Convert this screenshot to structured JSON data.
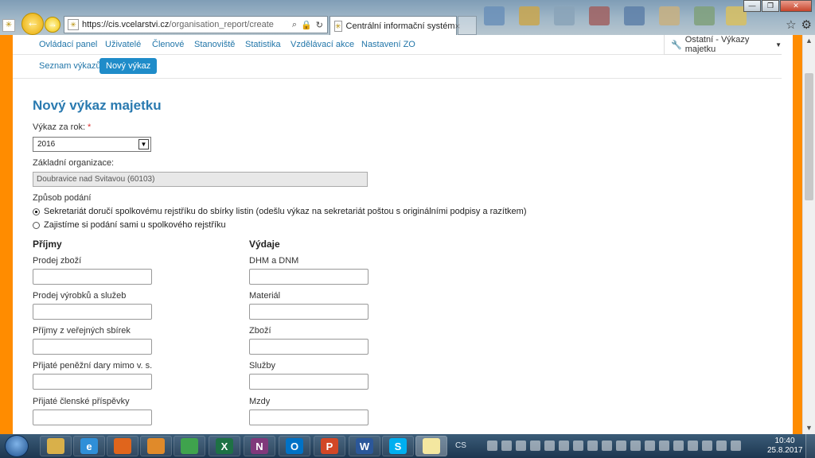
{
  "browser": {
    "url_host": "https://cis.vcelarstvi.cz",
    "url_path": "/organisation_report/create",
    "tab_title": "Centrální informační systém",
    "tab_close": "×"
  },
  "nav": {
    "items": [
      "Ovládací panel",
      "Uživatelé",
      "Členové",
      "Stanoviště",
      "Statistika",
      "Vzdělávací akce",
      "Nastavení ZO"
    ],
    "right_menu": "Ostatní - Výkazy majetku"
  },
  "subnav": {
    "link": "Seznam výkazů",
    "active": "Nový výkaz"
  },
  "form": {
    "title": "Nový výkaz majetku",
    "year_label": "Výkaz za rok:",
    "required_mark": "*",
    "year_value": "2016",
    "org_label": "Základní organizace:",
    "org_value": "Doubravice nad Svitavou (60103)",
    "method_label": "Způsob podání",
    "method_options": [
      {
        "label": "Sekretariát doručí spolkovému rejstříku do sbírky listin (odešlu výkaz na sekretariát poštou s originálními podpisy a razítkem)",
        "selected": true
      },
      {
        "label": "Zajistíme si podání sami u spolkového rejstříku",
        "selected": false
      }
    ],
    "income": {
      "heading": "Příjmy",
      "fields": [
        "Prodej zboží",
        "Prodej výrobků a služeb",
        "Příjmy z veřejných sbírek",
        "Přijaté peněžní dary mimo v. s.",
        "Přijaté členské příspěvky"
      ]
    },
    "expenses": {
      "heading": "Výdaje",
      "fields": [
        "DHM a DNM",
        "Materiál",
        "Zboží",
        "Služby",
        "Mzdy"
      ]
    }
  },
  "taskbar": {
    "apps": [
      {
        "name": "explorer",
        "glyph": "",
        "color": "#d9b04a"
      },
      {
        "name": "ie",
        "glyph": "e",
        "color": "#2f8fd8"
      },
      {
        "name": "firefox",
        "glyph": "",
        "color": "#e0651c"
      },
      {
        "name": "media",
        "glyph": "",
        "color": "#e08a2a"
      },
      {
        "name": "chrome",
        "glyph": "",
        "color": "#3fa34d"
      },
      {
        "name": "excel",
        "glyph": "X",
        "color": "#1e7145"
      },
      {
        "name": "onenote",
        "glyph": "N",
        "color": "#80397b"
      },
      {
        "name": "outlook",
        "glyph": "O",
        "color": "#0072c6"
      },
      {
        "name": "powerpoint",
        "glyph": "P",
        "color": "#d24726"
      },
      {
        "name": "word",
        "glyph": "W",
        "color": "#2b579a"
      },
      {
        "name": "skype",
        "glyph": "S",
        "color": "#00aff0"
      },
      {
        "name": "browser-active",
        "glyph": "",
        "color": "#f4e7a0"
      }
    ],
    "lang": "CS",
    "time": "10:40",
    "date": "25.8.2017"
  }
}
